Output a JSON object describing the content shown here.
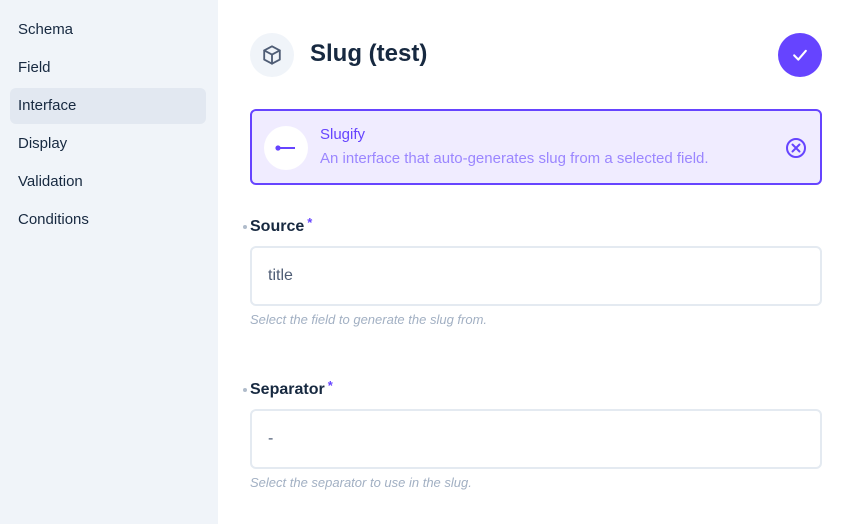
{
  "sidebar": {
    "items": [
      {
        "label": "Schema",
        "active": false
      },
      {
        "label": "Field",
        "active": false
      },
      {
        "label": "Interface",
        "active": true
      },
      {
        "label": "Display",
        "active": false
      },
      {
        "label": "Validation",
        "active": false
      },
      {
        "label": "Conditions",
        "active": false
      }
    ]
  },
  "header": {
    "title": "Slug (test)",
    "icon": "box-icon",
    "save_icon": "check-icon"
  },
  "interface": {
    "name": "Slugify",
    "description": "An interface that auto-generates slug from a selected field.",
    "icon": "slug-line-icon",
    "close_icon": "close-circle-icon"
  },
  "fields": {
    "source": {
      "label": "Source",
      "required_marker": "*",
      "value": "title",
      "hint": "Select the field to generate the slug from."
    },
    "separator": {
      "label": "Separator",
      "required_marker": "*",
      "value": "-",
      "hint": "Select the separator to use in the slug."
    }
  },
  "colors": {
    "accent": "#6644ff",
    "sidebar_bg": "#f0f4f9",
    "active_item_bg": "#e2e8f1",
    "text": "#172940"
  }
}
